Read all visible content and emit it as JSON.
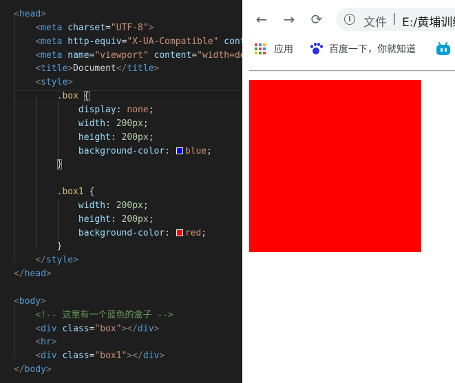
{
  "editor": {
    "lines": [
      [
        [
          "t-punct",
          "<"
        ],
        [
          "t-tag",
          "head"
        ],
        [
          "t-punct",
          ">"
        ]
      ],
      [
        [
          "t-text",
          "    "
        ],
        [
          "t-punct",
          "<"
        ],
        [
          "t-tag",
          "meta"
        ],
        [
          "t-text",
          " "
        ],
        [
          "t-attr",
          "charset"
        ],
        [
          "t-text",
          "="
        ],
        [
          "t-str",
          "\"UTF-8\""
        ],
        [
          "t-punct",
          ">"
        ]
      ],
      [
        [
          "t-text",
          "    "
        ],
        [
          "t-punct",
          "<"
        ],
        [
          "t-tag",
          "meta"
        ],
        [
          "t-text",
          " "
        ],
        [
          "t-attr",
          "http-equiv"
        ],
        [
          "t-text",
          "="
        ],
        [
          "t-str",
          "\"X-UA-Compatible\""
        ],
        [
          "t-text",
          " "
        ],
        [
          "t-attr",
          "content"
        ]
      ],
      [
        [
          "t-text",
          "    "
        ],
        [
          "t-punct",
          "<"
        ],
        [
          "t-tag",
          "meta"
        ],
        [
          "t-text",
          " "
        ],
        [
          "t-attr",
          "name"
        ],
        [
          "t-text",
          "="
        ],
        [
          "t-str",
          "\"viewport\""
        ],
        [
          "t-text",
          " "
        ],
        [
          "t-attr",
          "content"
        ],
        [
          "t-text",
          "="
        ],
        [
          "t-str",
          "\"width=device"
        ]
      ],
      [
        [
          "t-text",
          "    "
        ],
        [
          "t-punct",
          "<"
        ],
        [
          "t-tag",
          "title"
        ],
        [
          "t-punct",
          ">"
        ],
        [
          "t-text",
          "Document"
        ],
        [
          "t-punct",
          "</"
        ],
        [
          "t-tag",
          "title"
        ],
        [
          "t-punct",
          ">"
        ]
      ],
      [
        [
          "t-text",
          "    "
        ],
        [
          "t-punct",
          "<"
        ],
        [
          "t-tag",
          "style"
        ],
        [
          "t-punct",
          ">"
        ]
      ],
      [
        [
          "t-text",
          "        "
        ],
        [
          "t-sel",
          ".box"
        ],
        [
          "t-text",
          " "
        ],
        [
          "brace",
          "{"
        ]
      ],
      [
        [
          "t-text",
          "            "
        ],
        [
          "t-prop",
          "display"
        ],
        [
          "t-text",
          ": "
        ],
        [
          "t-val",
          "none"
        ],
        [
          "t-text",
          ";"
        ]
      ],
      [
        [
          "t-text",
          "            "
        ],
        [
          "t-prop",
          "width"
        ],
        [
          "t-text",
          ": "
        ],
        [
          "t-num",
          "200px"
        ],
        [
          "t-text",
          ";"
        ]
      ],
      [
        [
          "t-text",
          "            "
        ],
        [
          "t-prop",
          "height"
        ],
        [
          "t-text",
          ": "
        ],
        [
          "t-num",
          "200px"
        ],
        [
          "t-text",
          ";"
        ]
      ],
      [
        [
          "t-text",
          "            "
        ],
        [
          "t-prop",
          "background-color"
        ],
        [
          "t-text",
          ": "
        ],
        [
          "swatch",
          "blue"
        ],
        [
          "t-val",
          "blue"
        ],
        [
          "t-text",
          ";"
        ]
      ],
      [
        [
          "t-text",
          "        "
        ],
        [
          "brace",
          "}"
        ]
      ],
      [
        [
          "t-text",
          ""
        ]
      ],
      [
        [
          "t-text",
          "        "
        ],
        [
          "t-sel",
          ".box1"
        ],
        [
          "t-text",
          " {"
        ]
      ],
      [
        [
          "t-text",
          "            "
        ],
        [
          "t-prop",
          "width"
        ],
        [
          "t-text",
          ": "
        ],
        [
          "t-num",
          "200px"
        ],
        [
          "t-text",
          ";"
        ]
      ],
      [
        [
          "t-text",
          "            "
        ],
        [
          "t-prop",
          "height"
        ],
        [
          "t-text",
          ": "
        ],
        [
          "t-num",
          "200px"
        ],
        [
          "t-text",
          ";"
        ]
      ],
      [
        [
          "t-text",
          "            "
        ],
        [
          "t-prop",
          "background-color"
        ],
        [
          "t-text",
          ": "
        ],
        [
          "swatch",
          "red"
        ],
        [
          "t-val",
          "red"
        ],
        [
          "t-text",
          ";"
        ]
      ],
      [
        [
          "t-text",
          "        }"
        ]
      ],
      [
        [
          "t-text",
          "    "
        ],
        [
          "t-punct",
          "</"
        ],
        [
          "t-tag",
          "style"
        ],
        [
          "t-punct",
          ">"
        ]
      ],
      [
        [
          "t-punct",
          "</"
        ],
        [
          "t-tag",
          "head"
        ],
        [
          "t-punct",
          ">"
        ]
      ],
      [
        [
          "t-text",
          ""
        ]
      ],
      [
        [
          "t-punct",
          "<"
        ],
        [
          "t-tag",
          "body"
        ],
        [
          "t-punct",
          ">"
        ]
      ],
      [
        [
          "t-text",
          "    "
        ],
        [
          "t-com",
          "<!-- 这里有一个蓝色的盒子 -->"
        ]
      ],
      [
        [
          "t-text",
          "    "
        ],
        [
          "t-punct",
          "<"
        ],
        [
          "t-tag",
          "div"
        ],
        [
          "t-text",
          " "
        ],
        [
          "t-attr",
          "class"
        ],
        [
          "t-text",
          "="
        ],
        [
          "t-str",
          "\"box\""
        ],
        [
          "t-punct",
          "></"
        ],
        [
          "t-tag",
          "div"
        ],
        [
          "t-punct",
          ">"
        ]
      ],
      [
        [
          "t-text",
          "    "
        ],
        [
          "t-punct",
          "<"
        ],
        [
          "t-tag",
          "hr"
        ],
        [
          "t-punct",
          ">"
        ]
      ],
      [
        [
          "t-text",
          "    "
        ],
        [
          "t-punct",
          "<"
        ],
        [
          "t-tag",
          "div"
        ],
        [
          "t-text",
          " "
        ],
        [
          "t-attr",
          "class"
        ],
        [
          "t-text",
          "="
        ],
        [
          "t-str",
          "\"box1\""
        ],
        [
          "t-punct",
          "></"
        ],
        [
          "t-tag",
          "div"
        ],
        [
          "t-punct",
          ">"
        ]
      ],
      [
        [
          "t-punct",
          "</"
        ],
        [
          "t-tag",
          "body"
        ],
        [
          "t-punct",
          ">"
        ]
      ]
    ],
    "swatch_colors": {
      "blue": "#0000ff",
      "red": "#ff0000"
    }
  },
  "browser": {
    "nav": {
      "back": "←",
      "forward": "→",
      "reload": "⟳"
    },
    "omnibox": {
      "info": "i",
      "label": "文件",
      "separator": "|",
      "url": "E:/黄埔训练营"
    },
    "bookmarks": {
      "apps": "应用",
      "baidu": "百度一下，你就知道"
    },
    "page": {
      "box1_color": "#ff0000"
    }
  }
}
